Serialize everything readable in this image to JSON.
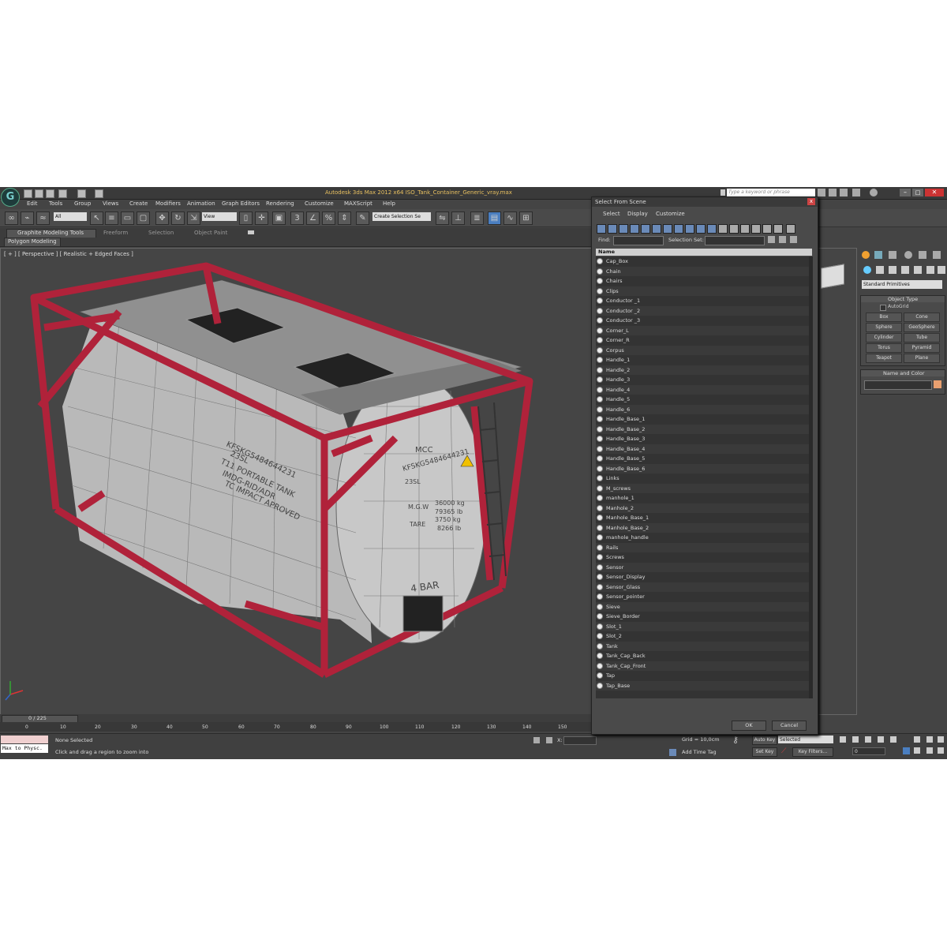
{
  "app": {
    "title": "Autodesk 3ds Max  2012 x64    ISO_Tank_Container_Generic_vray.max",
    "search_placeholder": "Type a keyword or phrase",
    "logo": "3ds-max-logo"
  },
  "menu": [
    "Edit",
    "Tools",
    "Group",
    "Views",
    "Create",
    "Modifiers",
    "Animation",
    "Graph Editors",
    "Rendering",
    "Customize",
    "MAXScript",
    "Help"
  ],
  "toolbar": {
    "selection_filter": "All",
    "reference_coord": "View",
    "named_selection": "Create Selection Se"
  },
  "ribbon": {
    "tabs": [
      "Graphite Modeling Tools",
      "Freeform",
      "Selection",
      "Object Paint"
    ],
    "subpanel": "Polygon Modeling"
  },
  "viewport": {
    "label": "[ + ] [ Perspective ] [ Realistic + Edged Faces ]",
    "model_text": {
      "side_id": "KFSKG5484644231",
      "side_line2": "23SL",
      "side_line3": "T11 PORTABLE TANK",
      "side_line4": "IMDG-RID/ADR",
      "side_line5": "TC IMPACT APROVED",
      "end_top": "MCC",
      "end_id": "KFSKG5484644231",
      "end_code": "23SL",
      "mgw_label": "M.G.W",
      "mgw_value": "36000 kg",
      "mgw_value2": "79365 lb",
      "tare_label": "TARE",
      "tare_value": "3750 kg",
      "tare_value2": "8266 lb",
      "pressure": "4 BAR"
    }
  },
  "command_panel": {
    "dropdown": "Standard Primitives",
    "object_type_title": "Object Type",
    "autogrid": "AutoGrid",
    "buttons": [
      "Box",
      "Cone",
      "Sphere",
      "GeoSphere",
      "Cylinder",
      "Tube",
      "Torus",
      "Pyramid",
      "Teapot",
      "Plane"
    ],
    "name_color_title": "Name and Color",
    "swatch_color": "#e8a070"
  },
  "timeline": {
    "frame": "0 / 225",
    "ticks": [
      "0",
      "10",
      "20",
      "30",
      "40",
      "50",
      "60",
      "70",
      "80",
      "90",
      "100",
      "110",
      "120",
      "130",
      "140",
      "150"
    ]
  },
  "status": {
    "maxscript": "Max to Physc.",
    "selection": "None Selected",
    "prompt": "Click and drag a region to zoom into",
    "x_label": "X:",
    "grid": "Grid = 10,0cm",
    "add_time_tag": "Add Time Tag",
    "auto_key": "Auto Key",
    "set_key": "Set Key",
    "selected": "Selected",
    "key_filters": "Key Filters...",
    "frame_field": "0"
  },
  "dialog": {
    "title": "Select From Scene",
    "close": "x",
    "menu": [
      "Select",
      "Display",
      "Customize"
    ],
    "find_label": "Find:",
    "selection_set_label": "Selection Set:",
    "column": "Name",
    "items": [
      "Cap_Box",
      "Chain",
      "Chairs",
      "Clips",
      "Conductor _1",
      "Conductor _2",
      "Conductor _3",
      "Corner_L",
      "Corner_R",
      "Corpus",
      "Handle_1",
      "Handle_2",
      "Handle_3",
      "Handle_4",
      "Handle_5",
      "Handle_6",
      "Handle_Base_1",
      "Handle_Base_2",
      "Handle_Base_3",
      "Handle_Base_4",
      "Handle_Base_5",
      "Handle_Base_6",
      "Links",
      "M_screws",
      "manhole_1",
      "Manhole_2",
      "Manhole_Base_1",
      "Manhole_Base_2",
      "manhole_handle",
      "Rails",
      "Screws",
      "Sensor",
      "Sensor_Display",
      "Sensor_Glass",
      "Sensor_pointer",
      "Sieve",
      "Sieve_Border",
      "Slot_1",
      "Slot_2",
      "Tank",
      "Tank_Cap_Back",
      "Tank_Cap_Front",
      "Tap",
      "Tap_Base"
    ],
    "ok": "OK",
    "cancel": "Cancel"
  }
}
